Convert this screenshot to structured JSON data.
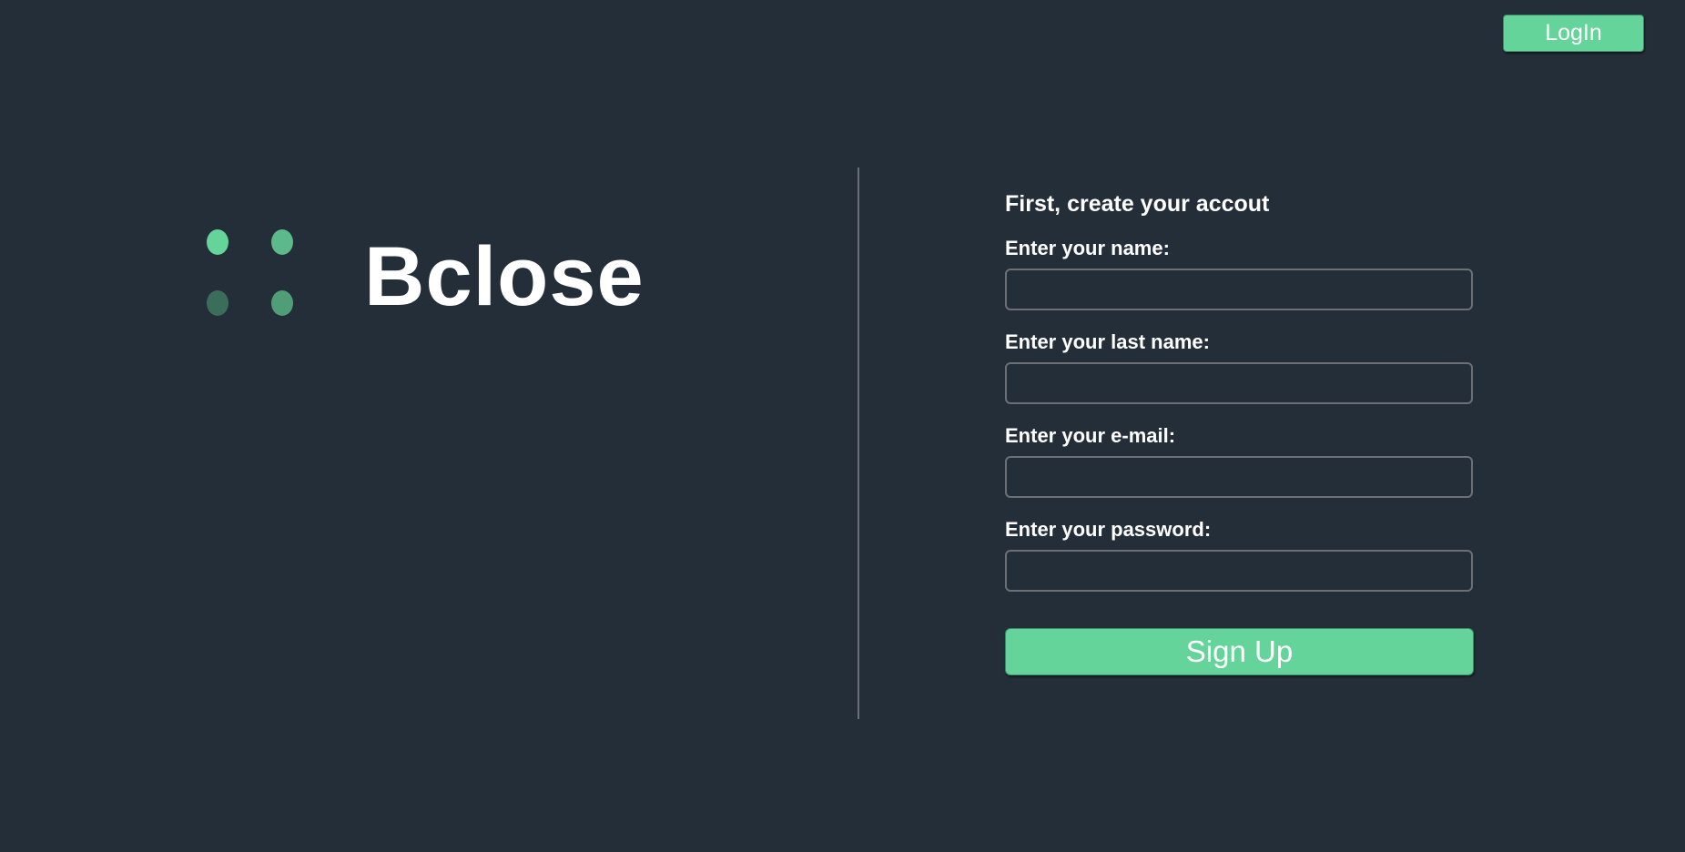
{
  "header": {
    "login_label": "LogIn"
  },
  "brand": {
    "name": "Bclose",
    "dot_colors": [
      "#64d49a",
      "#5bb98a",
      "#3a6e5a",
      "#4f9e78"
    ]
  },
  "form": {
    "title": "First, create your accout",
    "fields": [
      {
        "label": "Enter your name:",
        "value": "",
        "placeholder": ""
      },
      {
        "label": "Enter your last name:",
        "value": "",
        "placeholder": ""
      },
      {
        "label": "Enter your e-mail:",
        "value": "",
        "placeholder": ""
      },
      {
        "label": "Enter your password:",
        "value": "",
        "placeholder": ""
      }
    ],
    "submit_label": "Sign Up"
  },
  "colors": {
    "background": "#242e38",
    "accent": "#64d49a",
    "divider": "#6a7079"
  }
}
